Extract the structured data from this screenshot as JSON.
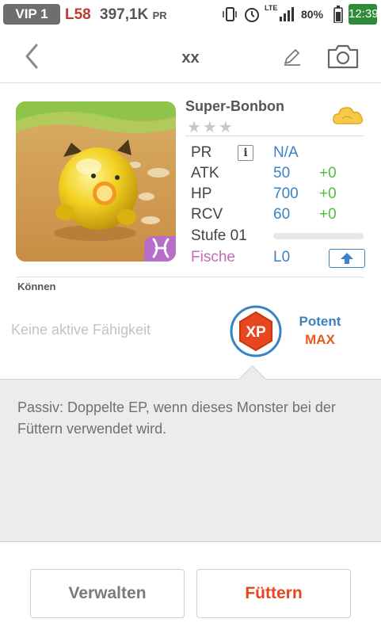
{
  "status_bar": {
    "vip": "VIP 1",
    "level": "L58",
    "power": "397,1K",
    "power_unit": "PR",
    "network": "LTE",
    "battery": "80%",
    "time": "12:39"
  },
  "header": {
    "title": "xx",
    "back_icon": "chevron-left-icon",
    "edit_icon": "pencil-icon",
    "camera_icon": "camera-icon"
  },
  "monster": {
    "name": "Super-Bonbon",
    "stars": "★★★",
    "element_icon": "cloud-icon",
    "sign_icon": "pisces-icon",
    "stats": {
      "pr_label": "PR",
      "pr_value": "N/A",
      "info_icon": "i",
      "atk_label": "ATK",
      "atk_value": "50",
      "atk_bonus": "+0",
      "hp_label": "HP",
      "hp_value": "700",
      "hp_bonus": "+0",
      "rcv_label": "RCV",
      "rcv_value": "60",
      "rcv_bonus": "+0",
      "level_label": "Stufe 01",
      "level_progress": 0,
      "fish_label": "Fische",
      "fish_value": "L0"
    }
  },
  "skills": {
    "section_title": "Können",
    "active_skill": "Keine aktive Fähigkeit",
    "badge_text": "XP",
    "potency_label": "Potent",
    "potency_value": "MAX",
    "passive_text": "Passiv: Doppelte EP, wenn dieses Monster bei der Füttern verwendet wird."
  },
  "actions": {
    "manage_label": "Verwalten",
    "feed_label": "Füttern"
  },
  "colors": {
    "accent_blue": "#3b82c4",
    "bonus_green": "#4fbf3a",
    "feed_orange": "#e8461e",
    "fish_pink": "#c36ab8"
  }
}
